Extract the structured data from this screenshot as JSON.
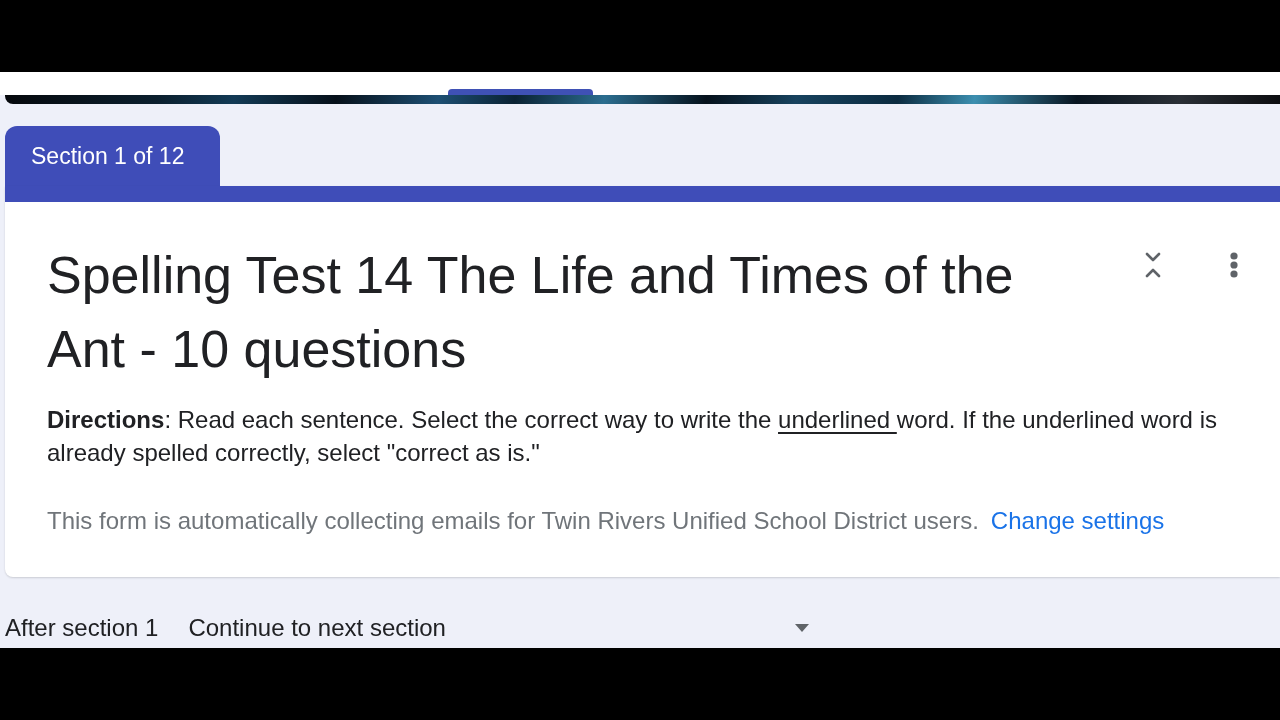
{
  "header": {
    "tabs": [
      {
        "selected": true
      },
      {
        "selected": false
      },
      {
        "selected": false
      }
    ]
  },
  "section": {
    "label": "Section 1 of 12",
    "title": "Spelling Test 14 The Life and Times of the Ant - 10 questions",
    "directions": [
      {
        "text": "**Directions**: Read each sentence. Select the correct way to write the ",
        "underlined": false
      },
      {
        "text": "underlined ",
        "underlined": true
      },
      {
        "text": "word. If the underlined word is already spelled correctly, select \"correct as is.\"",
        "underlined": false
      }
    ],
    "email_notice": "This form is automatically collecting emails for Twin Rivers Unified School District users.",
    "email_link": "Change settings"
  },
  "after_section": {
    "label": "After section 1",
    "value": "Continue to next section"
  }
}
